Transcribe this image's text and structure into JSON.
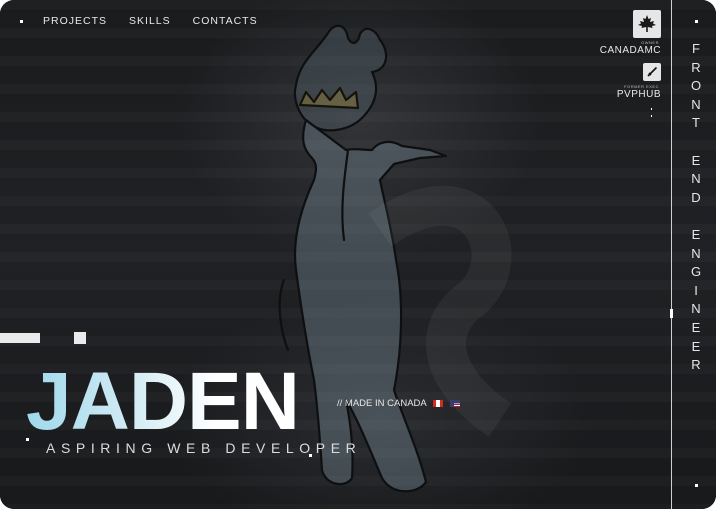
{
  "nav": {
    "items": [
      "PROJECTS",
      "SKILLS",
      "CONTACTS"
    ]
  },
  "badges": [
    {
      "icon": "maple-leaf-icon",
      "role": "OWNER",
      "name": "CANADAMC"
    },
    {
      "icon": "sword-icon",
      "role": "FORMER EXEC",
      "name": "PVPHUB"
    }
  ],
  "side_title": [
    "F",
    "R",
    "O",
    "N",
    "T",
    "",
    "E",
    "N",
    "D",
    "",
    "E",
    "N",
    "G",
    "I",
    "N",
    "E",
    "E",
    "R"
  ],
  "hero": {
    "name": "JADEN",
    "subtitle": "ASPIRING WEB DEVELOPER",
    "made_in": "// MADE IN CANADA"
  },
  "colors": {
    "background": "#1b1c1e",
    "accent_gradient_start": "#9fd8ec",
    "text": "#e8e8e8"
  }
}
